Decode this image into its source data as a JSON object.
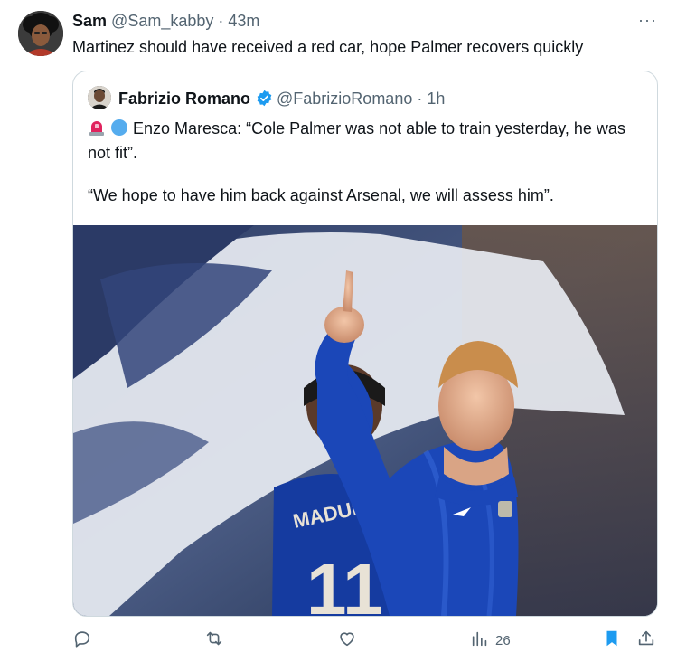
{
  "tweet": {
    "author_name": "Sam",
    "author_handle": "@Sam_kabby",
    "separator": "·",
    "time": "43m",
    "more": "···",
    "text": "Martinez should have received a red car, hope Palmer recovers quickly"
  },
  "quote": {
    "author_name": "Fabrizio Romano",
    "author_handle": "@FabrizioRomano",
    "separator": "·",
    "time": "1h",
    "verified_icon": "verified-badge-icon",
    "line1": "Enzo Maresca: “Cole Palmer was not able to train yesterday, he was not fit”.",
    "line2": "“We hope to have him back against Arsenal, we will assess him”.",
    "emojis": [
      "siren-emoji",
      "blue-circle-emoji"
    ],
    "photo": {
      "shirt_name": "MADUEKE",
      "shirt_number": "11"
    }
  },
  "actions": {
    "reply_icon": "reply-icon",
    "retweet_icon": "retweet-icon",
    "like_icon": "heart-icon",
    "views_icon": "views-chart-icon",
    "views_count": "26",
    "bookmark_icon": "bookmark-icon",
    "share_icon": "share-icon"
  },
  "colors": {
    "accent": "#1d9bf0",
    "text": "#0f1419",
    "muted": "#536471",
    "border": "#cfd9de",
    "bookmark": "#1d9bf0"
  }
}
